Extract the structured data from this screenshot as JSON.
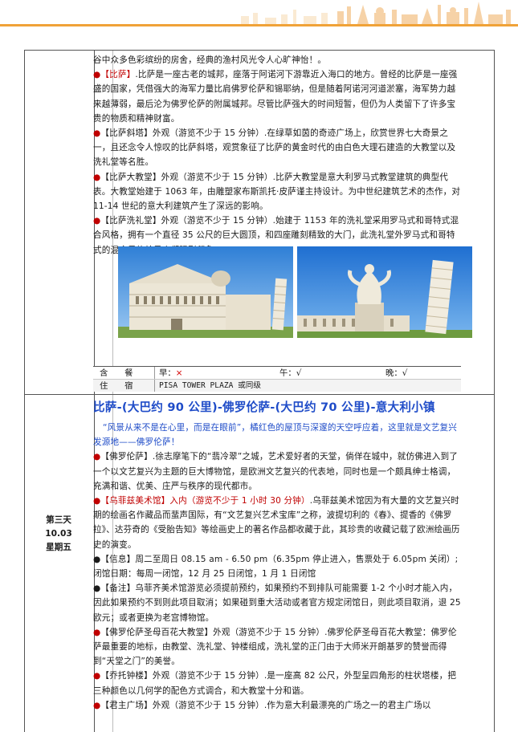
{
  "colors": {
    "accent": "#c00000",
    "link_blue": "#1f4cc8",
    "header_orange": "#f0a238"
  },
  "block1": {
    "lines": [
      "谷中众多色彩缤纷的房舍，经典的渔村风光令人心旷神怡！。"
    ],
    "pisa": {
      "bullet": "●",
      "tag": "【比萨】",
      "text": ".比萨是一座古老的城邦，座落于阿诺河下游靠近入海口的地方。曾经的比萨是一座强盛的国家，凭借强大的海军力量比肩佛罗伦萨和锡耶纳，但是随着阿诺河河道淤塞，海军势力越来越薄弱，最后沦为佛罗伦萨的附属城邦。尽管比萨强大的时间短暂，但仍为人类留下了许多宝贵的物质和精神财富。"
    },
    "tower": {
      "bullet": "●",
      "tag": "【比萨斜塔】",
      "text": "外观（游览不少于 15 分钟）.在绿草如茵的奇迹广场上，欣赏世界七大奇景之一，且还念令人惊叹的比萨斜塔，观赏象征了比萨的黄金时代的由白色大理石建造的大教堂以及洗礼堂等名胜。"
    },
    "cathedral": {
      "bullet": "●",
      "tag": "【比萨大教堂】",
      "text": "外观（游览不少于 15 分钟）.比萨大教堂是意大利罗马式教堂建筑的典型代表。大教堂始建于 1063 年，由雕塑家布斯凯托·皮萨谨主持设计。为中世纪建筑艺术的杰作，对 11-14 世纪的意大利建筑产生了深远的影响。"
    },
    "baptistery": {
      "bullet": "●",
      "tag": "【比萨洗礼堂】",
      "text": "外观（游览不少于 15 分钟）.始建于 1153 年的洗礼堂采用罗马式和哥特式混合风格，拥有一个直径 35 公尺的巨大圆顶，和四座雕刻精致的大门，此洗礼堂外罗马式和哥特式的混合风格给予人们强烈印象。"
    }
  },
  "meals": {
    "label_meals": "含　　餐",
    "label_hotel": "住　　宿",
    "breakfast_label": "早：",
    "breakfast_value": "×",
    "lunch_label": "午：",
    "lunch_value": "√",
    "dinner_label": "晚：",
    "dinner_value": "√",
    "hotel": "PISA TOWER PLAZA 或同级"
  },
  "day3": {
    "day": "第三天",
    "date": "10.03",
    "weekday": "星期五",
    "route": "比萨-(大巴约 90 公里)-佛罗伦萨-(大巴约 70 公里)-意大利小镇",
    "quote": "“风景从来不是在心里，而是在眼前”，橘红色的屋顶与深邃的天空呼应着，这里就是文艺复兴发源地——佛罗伦萨！",
    "florence": {
      "bullet": "●",
      "tag": "【佛罗伦萨】",
      "text": ".徐志摩笔下的“翡冷翠”之城，艺术爱好者的天堂，倘佯在城中，就仿佛进入到了一个以文艺复兴为主题的巨大博物馆，是欧洲文艺复兴的代表地，同时也是一个颇具绅士格调，充满和谐、优美、庄严与秩序的现代都市。"
    },
    "uffizi": {
      "bullet": "●",
      "tag": "【乌菲兹美术馆】入内（游览不少于 1 小时 30 分钟）",
      "text": ".乌菲兹美术馆因为有大量的文艺复兴时期的绘画名作藏品而蜚声国际，有“文艺复兴艺术宝库”之称，波提切利的《春》、提香的《佛罗拉》、达芬奇的《受胎告知》等绘画史上的著名作品都收藏于此，其珍贵的收藏记载了欧洲绘画历史的演变。"
    },
    "info": {
      "bullet": "●",
      "text": "【信息】周二至周日 08.15 am - 6.50 pm（6.35pm 停止进入，售票处于 6.05pm 关闭）;闭馆日期：每周一闭馆，12 月 25 日闭馆，1 月 1 日闭馆"
    },
    "note": {
      "bullet": "●",
      "text": "【备注】乌菲齐美术馆游览必须提前预约，如果预约不到排队可能需要 1-2 个小时才能入内，因此如果预约不到则此项目取消；如果碰到重大活动或者官方规定闭馆日，则此项目取消，退 25 欧元；或者更换为老宫博物馆。"
    },
    "duomo": {
      "bullet": "●",
      "tag": "【佛罗伦萨圣母百花大教堂】",
      "text": "外观（游览不少于 15 分钟）.佛罗伦萨圣母百花大教堂：佛罗伦萨最重要的地标，由教堂、洗礼堂、钟楼组成，洗礼堂的正门由于大师米开朗基罗的赞誉而得到“天堂之门”的美誉。"
    },
    "giotto": {
      "bullet": "●",
      "tag": "【乔托钟楼】",
      "text": "外观（游览不少于 15 分钟）.是一座高 82 公尺，外型呈四角形的柱状塔楼，把三种颜色以几何学的配色方式调合，和大教堂十分和谐。"
    },
    "signoria": {
      "bullet": "●",
      "tag": "【君主广场】",
      "text": "外观（游览不少于 15 分钟）.作为意大利最漂亮的广场之一的君主广场以"
    }
  },
  "photos": [
    {
      "name": "pisa-cathedral-photo"
    },
    {
      "name": "pisa-tower-statue-photo"
    }
  ]
}
